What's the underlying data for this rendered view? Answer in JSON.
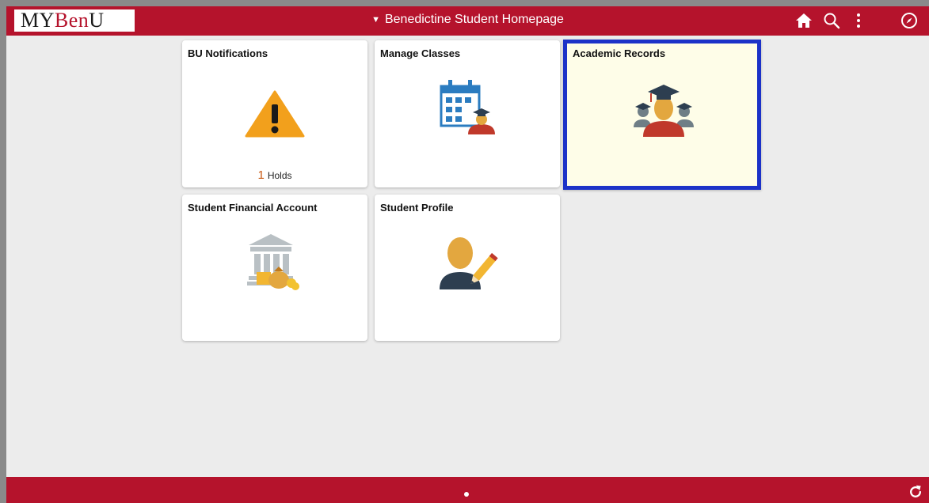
{
  "header": {
    "logo": {
      "my": "MY",
      "ben": "Ben",
      "u": "U"
    },
    "title": "Benedictine Student Homepage",
    "icons": [
      "home-icon",
      "search-icon",
      "actions-menu-icon",
      "navbar-compass-icon"
    ]
  },
  "tiles": [
    {
      "title": "BU Notifications",
      "icon": "warning-icon",
      "count": "1",
      "count_label": "Holds"
    },
    {
      "title": "Manage Classes",
      "icon": "calendar-student-icon"
    },
    {
      "title": "Academic Records",
      "icon": "graduates-icon",
      "selected": true
    },
    {
      "title": "Student Financial Account",
      "icon": "bank-money-icon"
    },
    {
      "title": "Student Profile",
      "icon": "profile-edit-icon"
    }
  ],
  "footer": {
    "page_indicator_icon": "page-dot-icon",
    "refresh_icon": "refresh-icon"
  },
  "colors": {
    "brand": "#b5132c",
    "selected_border": "#1c32c8",
    "selected_bg": "#fefde8",
    "hold_count": "#c85a13"
  }
}
